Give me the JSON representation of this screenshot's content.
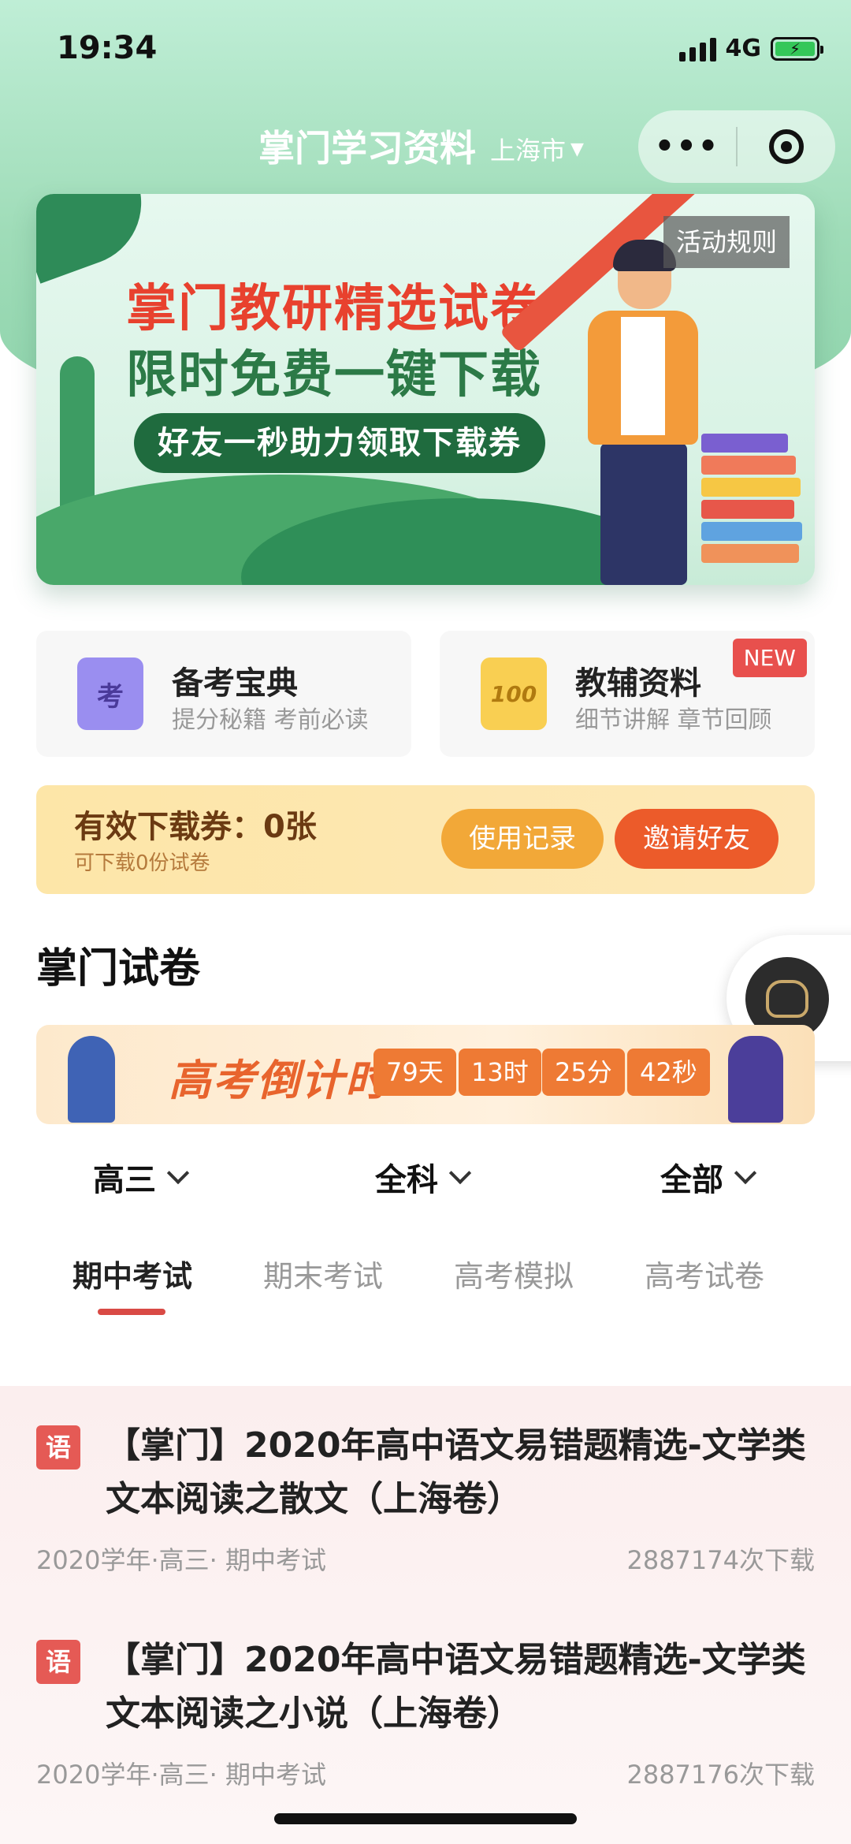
{
  "status": {
    "time": "19:34",
    "network": "4G"
  },
  "nav": {
    "title": "掌门学习资料",
    "city": "上海市",
    "more_label": "•••"
  },
  "banner": {
    "headline": "掌门教研精选试卷",
    "subheadline": "限时免费一键下载",
    "pill": "好友一秒助力领取下载券",
    "rules_button": "活动规则"
  },
  "quick_cards": [
    {
      "title": "备考宝典",
      "subtitle": "提分秘籍 考前必读",
      "icon_text": "考",
      "icon": "book-icon"
    },
    {
      "title": "教辅资料",
      "subtitle": "细节讲解 章节回顾",
      "icon_text": "100",
      "icon": "score-paper-icon",
      "badge": "NEW"
    }
  ],
  "coupon": {
    "title": "有效下载券：0张",
    "subtitle": "可下载0份试卷",
    "record_button": "使用记录",
    "invite_button": "邀请好友"
  },
  "section_title": "掌门试卷",
  "countdown": {
    "title": "高考倒计时",
    "days": "79天",
    "hours": "13时",
    "minutes": "25分",
    "seconds": "42秒"
  },
  "filters": [
    {
      "label": "高三"
    },
    {
      "label": "全科"
    },
    {
      "label": "全部"
    }
  ],
  "tabs": [
    {
      "label": "期中考试",
      "active": true
    },
    {
      "label": "期末考试",
      "active": false
    },
    {
      "label": "高考模拟",
      "active": false
    },
    {
      "label": "高考试卷",
      "active": false
    }
  ],
  "papers": [
    {
      "subject_badge": "语",
      "title": "【掌门】2020年高中语文易错题精选-文学类文本阅读之散文（上海卷）",
      "meta": "2020学年·高三· 期中考试",
      "downloads": "2887174次下载"
    },
    {
      "subject_badge": "语",
      "title": "【掌门】2020年高中语文易错题精选-文学类文本阅读之小说（上海卷）",
      "meta": "2020学年·高三· 期中考试",
      "downloads": "2887176次下载"
    }
  ],
  "colors": {
    "header_green": "#9fdcb8",
    "accent_red": "#d94a45",
    "invite_orange": "#ec5b2a",
    "record_orange": "#f2a838"
  }
}
